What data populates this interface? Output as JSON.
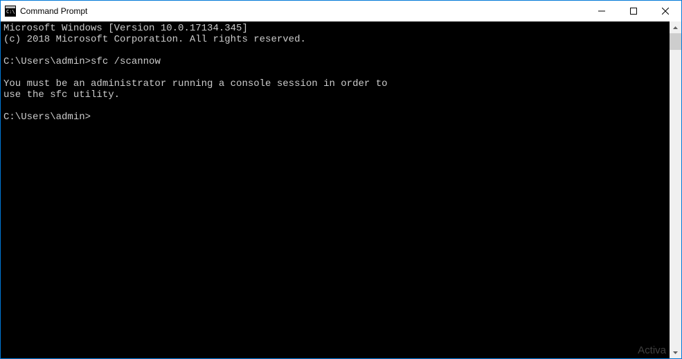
{
  "window": {
    "title": "Command Prompt"
  },
  "console": {
    "line1": "Microsoft Windows [Version 10.0.17134.345]",
    "line2": "(c) 2018 Microsoft Corporation. All rights reserved.",
    "blank1": "",
    "prompt1": "C:\\Users\\admin>",
    "command1": "sfc /scannow",
    "blank2": "",
    "msg1": "You must be an administrator running a console session in order to",
    "msg2": "use the sfc utility.",
    "blank3": "",
    "prompt2": "C:\\Users\\admin>"
  },
  "watermark": "Activa"
}
